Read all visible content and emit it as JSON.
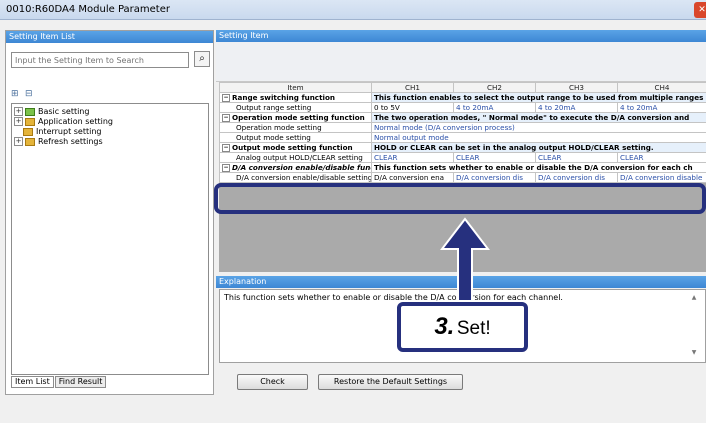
{
  "window": {
    "title": "0010:R60DA4 Module Parameter"
  },
  "left_pane": {
    "header": "Setting Item List",
    "search_placeholder": "Input the Setting Item to Search",
    "tree": [
      {
        "label": "Basic setting"
      },
      {
        "label": "Application setting"
      },
      {
        "label": "Interrupt setting"
      },
      {
        "label": "Refresh settings"
      }
    ],
    "tabs": [
      {
        "label": "Item List"
      },
      {
        "label": "Find Result"
      }
    ]
  },
  "right_pane": {
    "header": "Setting Item",
    "columns": [
      "Item",
      "CH1",
      "CH2",
      "CH3",
      "CH4"
    ],
    "rows": [
      {
        "item": "Range switching function",
        "desc": "This function enables to select the output range to be used from multiple ranges"
      },
      {
        "item": "Output range setting",
        "ch": [
          "0 to 5V",
          "4 to 20mA",
          "4 to 20mA",
          "4 to 20mA"
        ]
      },
      {
        "item": "Operation mode setting function",
        "desc": "The two operation modes, \" Normal mode\" to execute the D/A conversion and"
      },
      {
        "item": "Operation mode setting",
        "desc": "Normal mode (D/A conversion process)"
      },
      {
        "item": "Output mode setting",
        "desc": "Normal output mode"
      },
      {
        "item": "Output mode setting function",
        "desc": "HOLD or CLEAR can be set in the analog output HOLD/CLEAR setting."
      },
      {
        "item": "Analog output HOLD/CLEAR setting",
        "ch": [
          "CLEAR",
          "CLEAR",
          "CLEAR",
          "CLEAR"
        ]
      },
      {
        "item": "D/A conversion enable/disable function",
        "desc": "This function sets whether to enable or disable the D/A conversion for each ch"
      },
      {
        "item": "D/A conversion enable/disable setting",
        "ch": [
          "D/A conversion ena",
          "D/A conversion dis",
          "D/A conversion dis",
          "D/A conversion disable"
        ]
      }
    ]
  },
  "explanation": {
    "header": "Explanation",
    "text": "This function sets whether to enable or disable the D/A conversion for each channel."
  },
  "buttons": {
    "check": "Check",
    "restore": "Restore the Default Settings"
  },
  "callout": {
    "number": "3.",
    "text": "Set!"
  },
  "colors": {
    "accent": "#26307e",
    "header_blue": "#3d87d4"
  }
}
